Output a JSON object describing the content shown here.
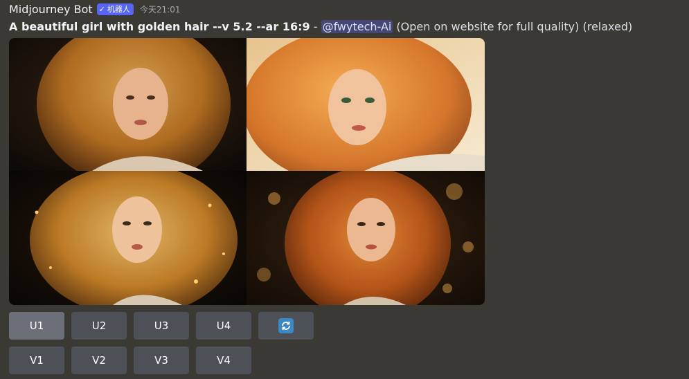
{
  "message": {
    "author": "Midjourney Bot",
    "badge": {
      "check": "✓",
      "label": "机器人"
    },
    "timestamp": "今天21:01",
    "prompt": "A beautiful girl with golden hair --v 5.2 --ar 16:9",
    "separator": " - ",
    "mention": "@fwytech-Ai",
    "suffix": " (Open on website for full quality) (relaxed)"
  },
  "image_grid": {
    "tiles": [
      {
        "name": "image-1",
        "subject": "girl with golden hair, dark background"
      },
      {
        "name": "image-2",
        "subject": "girl with golden hair, light background"
      },
      {
        "name": "image-3",
        "subject": "girl with golden hair, dark sparkles"
      },
      {
        "name": "image-4",
        "subject": "girl with red-golden hair, bokeh"
      }
    ]
  },
  "buttons": {
    "upscale": [
      "U1",
      "U2",
      "U3",
      "U4"
    ],
    "variation": [
      "V1",
      "V2",
      "V3",
      "V4"
    ],
    "reroll_icon": "refresh-icon"
  },
  "colors": {
    "background": "#3b3934",
    "badge": "#5865f2",
    "button": "#4e5058",
    "button_active": "#6d6f78",
    "mention_bg": "#4a5199",
    "refresh": "#3b88c3"
  }
}
